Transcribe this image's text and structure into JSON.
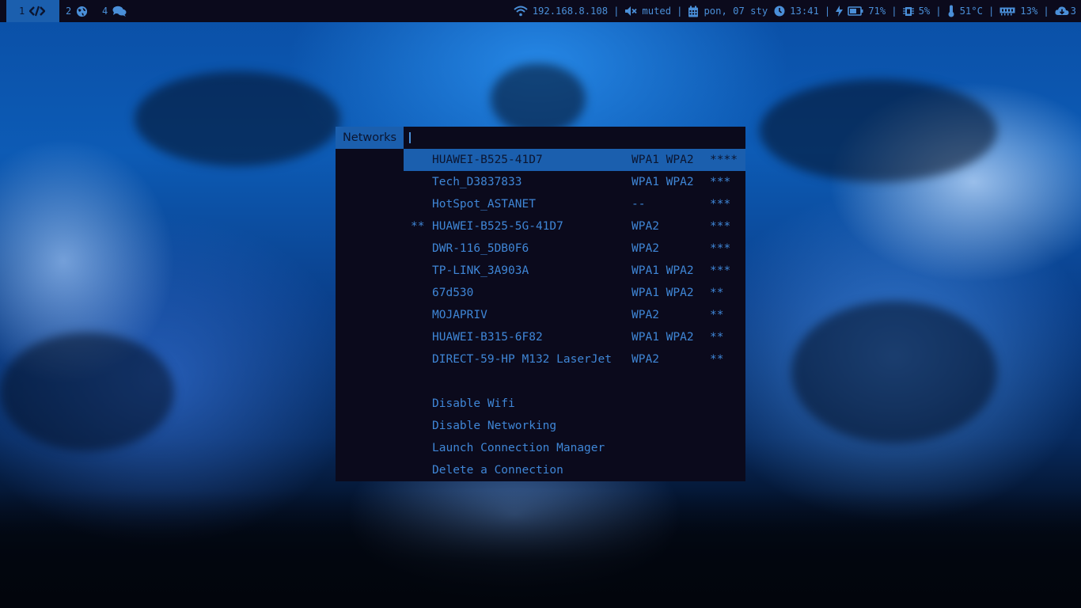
{
  "topbar": {
    "workspaces": [
      {
        "num": "1",
        "icon": "code-icon",
        "active": true
      },
      {
        "num": "2",
        "icon": "globe-icon",
        "active": false
      },
      {
        "num": "4",
        "icon": "comments-icon",
        "active": false
      }
    ],
    "status": {
      "ip": "192.168.8.108",
      "volume": "muted",
      "date": "pon, 07 sty",
      "time": "13:41",
      "battery": "71%",
      "cpu": "5%",
      "temperature": "51°C",
      "memory": "13%",
      "updates": "3",
      "separator": "|"
    }
  },
  "menu": {
    "prompt": "Networks",
    "input_value": "",
    "networks": [
      {
        "mark": "",
        "ssid": "HUAWEI-B525-41D7",
        "security": "WPA1 WPA2",
        "signal": "****",
        "selected": true
      },
      {
        "mark": "",
        "ssid": "Tech_D3837833",
        "security": "WPA1 WPA2",
        "signal": "***",
        "selected": false
      },
      {
        "mark": "",
        "ssid": "HotSpot_ASTANET",
        "security": "--",
        "signal": "***",
        "selected": false
      },
      {
        "mark": "**",
        "ssid": "HUAWEI-B525-5G-41D7",
        "security": "WPA2",
        "signal": "***",
        "selected": false
      },
      {
        "mark": "",
        "ssid": "DWR-116_5DB0F6",
        "security": "WPA2",
        "signal": "***",
        "selected": false
      },
      {
        "mark": "",
        "ssid": "TP-LINK_3A903A",
        "security": "WPA1 WPA2",
        "signal": "***",
        "selected": false
      },
      {
        "mark": "",
        "ssid": "67d530",
        "security": "WPA1 WPA2",
        "signal": "**",
        "selected": false
      },
      {
        "mark": "",
        "ssid": "MOJAPRIV",
        "security": "WPA2",
        "signal": "**",
        "selected": false
      },
      {
        "mark": "",
        "ssid": "HUAWEI-B315-6F82",
        "security": "WPA1 WPA2",
        "signal": "**",
        "selected": false
      },
      {
        "mark": "",
        "ssid": "DIRECT-59-HP M132 LaserJet",
        "security": "WPA2",
        "signal": "**",
        "selected": false
      }
    ],
    "actions": [
      "Disable Wifi",
      "Disable Networking",
      "Launch Connection Manager",
      "Delete a Connection"
    ]
  },
  "colors": {
    "bar_bg": "#0b0a1c",
    "accent": "#1b5fae",
    "text": "#4a8fd8",
    "selected_text": "#0b1530"
  }
}
